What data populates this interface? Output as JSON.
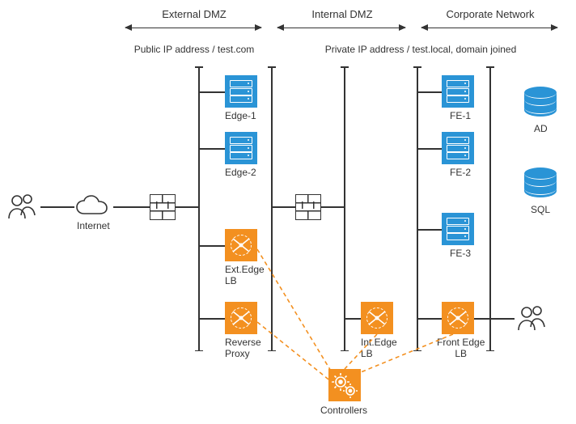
{
  "zones": {
    "external": "External DMZ",
    "internal": "Internal DMZ",
    "corporate": "Corporate Network"
  },
  "subheaders": {
    "public": "Public IP address / test.com",
    "private": "Private IP address / test.local, domain joined"
  },
  "left": {
    "internet": "Internet"
  },
  "external_nodes": {
    "edge1": "Edge-1",
    "edge2": "Edge-2",
    "extedge_lb_line1": "Ext.Edge",
    "extedge_lb_line2": "LB",
    "reverse_proxy_line1": "Reverse",
    "reverse_proxy_line2": "Proxy"
  },
  "internal_nodes": {
    "intedge_lb_line1": "Int.Edge",
    "intedge_lb_line2": "LB"
  },
  "corporate_nodes": {
    "fe1": "FE-1",
    "fe2": "FE-2",
    "fe3": "FE-3",
    "front_edge_line1": "Front Edge",
    "front_edge_line2": "LB"
  },
  "right": {
    "ad": "AD",
    "sql": "SQL"
  },
  "bottom": {
    "controllers": "Controllers"
  }
}
